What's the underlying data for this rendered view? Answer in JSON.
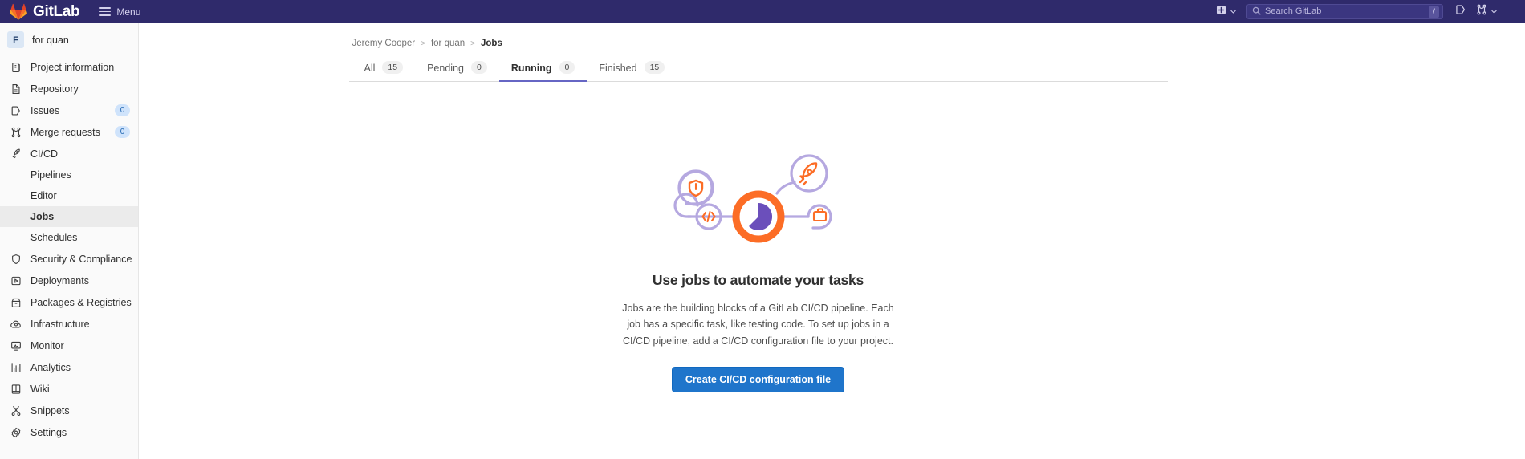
{
  "navbar": {
    "brand": "GitLab",
    "brand_logo_icon": "gitlab-tanuki-icon",
    "menu_label": "Menu",
    "menu_icon": "hamburger-icon",
    "create_new_icon": "plus-square-icon",
    "create_new_chevron_icon": "chevron-down-icon",
    "search": {
      "placeholder": "Search GitLab",
      "icon": "search-icon",
      "shortcut_badge": "/"
    },
    "issues_icon": "issues-icon",
    "merge_requests_icon": "merge-request-icon",
    "merge_requests_chevron_icon": "chevron-down-icon",
    "bg_color": "#2f2a6b"
  },
  "sidebar": {
    "project": {
      "avatar_initial": "F",
      "name": "for quan"
    },
    "items": [
      {
        "label": "Project information",
        "icon": "doc-info-icon",
        "badge": null,
        "sub": false,
        "active": false
      },
      {
        "label": "Repository",
        "icon": "repository-icon",
        "badge": null,
        "sub": false,
        "active": false
      },
      {
        "label": "Issues",
        "icon": "issues-icon",
        "badge": "0",
        "sub": false,
        "active": false
      },
      {
        "label": "Merge requests",
        "icon": "merge-request-icon",
        "badge": "0",
        "sub": false,
        "active": false
      },
      {
        "label": "CI/CD",
        "icon": "rocket-icon",
        "badge": null,
        "sub": false,
        "active": false
      },
      {
        "label": "Pipelines",
        "icon": null,
        "badge": null,
        "sub": true,
        "active": false
      },
      {
        "label": "Editor",
        "icon": null,
        "badge": null,
        "sub": true,
        "active": false
      },
      {
        "label": "Jobs",
        "icon": null,
        "badge": null,
        "sub": true,
        "active": true
      },
      {
        "label": "Schedules",
        "icon": null,
        "badge": null,
        "sub": true,
        "active": false
      },
      {
        "label": "Security & Compliance",
        "icon": "shield-icon",
        "badge": null,
        "sub": false,
        "active": false
      },
      {
        "label": "Deployments",
        "icon": "deployments-icon",
        "badge": null,
        "sub": false,
        "active": false
      },
      {
        "label": "Packages & Registries",
        "icon": "package-icon",
        "badge": null,
        "sub": false,
        "active": false
      },
      {
        "label": "Infrastructure",
        "icon": "cloud-gear-icon",
        "badge": null,
        "sub": false,
        "active": false
      },
      {
        "label": "Monitor",
        "icon": "monitor-icon",
        "badge": null,
        "sub": false,
        "active": false
      },
      {
        "label": "Analytics",
        "icon": "chart-icon",
        "badge": null,
        "sub": false,
        "active": false
      },
      {
        "label": "Wiki",
        "icon": "book-icon",
        "badge": null,
        "sub": false,
        "active": false
      },
      {
        "label": "Snippets",
        "icon": "scissors-icon",
        "badge": null,
        "sub": false,
        "active": false
      },
      {
        "label": "Settings",
        "icon": "gear-icon",
        "badge": null,
        "sub": false,
        "active": false
      }
    ]
  },
  "breadcrumb": {
    "items": [
      "Jeremy Cooper",
      "for quan",
      "Jobs"
    ],
    "separator": ">"
  },
  "tabs": [
    {
      "label": "All",
      "count": "15",
      "active": false
    },
    {
      "label": "Pending",
      "count": "0",
      "active": false
    },
    {
      "label": "Running",
      "count": "0",
      "active": true
    },
    {
      "label": "Finished",
      "count": "15",
      "active": false
    }
  ],
  "empty_state": {
    "illustration_icon": "ci-cd-pipeline-illustration",
    "illustration_icons": [
      "shield-icon",
      "code-brackets-icon",
      "rocket-icon",
      "briefcase-icon",
      "pie-timer-icon"
    ],
    "title": "Use jobs to automate your tasks",
    "description": "Jobs are the building blocks of a GitLab CI/CD pipeline. Each job has a specific task, like testing code. To set up jobs in a CI/CD pipeline, add a CI/CD configuration file to your project.",
    "cta_label": "Create CI/CD configuration file",
    "cta_color": "#1f75cb",
    "accent_orange": "#fc6d26",
    "accent_purple": "#6b4fbb",
    "accent_lavender": "#b5a8e0"
  }
}
